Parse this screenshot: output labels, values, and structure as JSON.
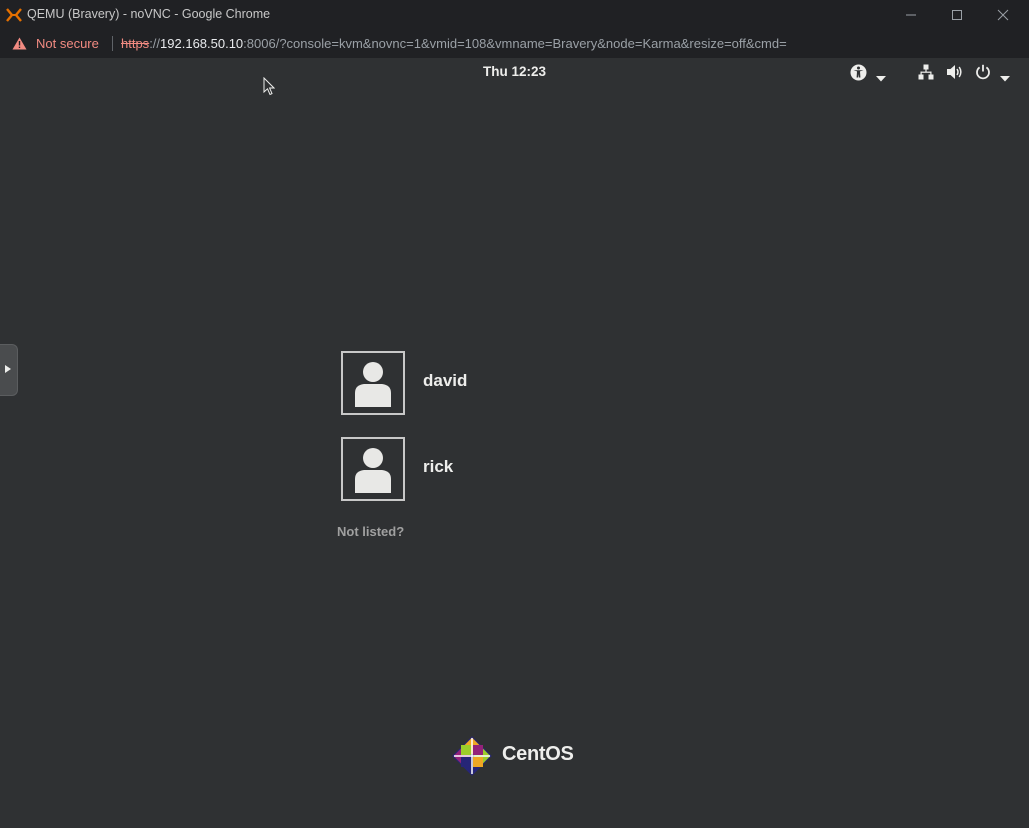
{
  "browser": {
    "window_title": "QEMU (Bravery) - noVNC - Google Chrome",
    "security_label": "Not secure",
    "url": {
      "scheme": "https",
      "separator": "://",
      "host": "192.168.50.10",
      "rest": ":8006/?console=kvm&novnc=1&vmid=108&vmname=Bravery&node=Karma&resize=off&cmd="
    },
    "window_buttons": [
      "minimize-icon",
      "maximize-icon",
      "close-icon"
    ]
  },
  "gnome": {
    "clock": "Thu 12:23",
    "tray_icons": [
      "accessibility-icon",
      "network-icon",
      "volume-icon",
      "power-icon"
    ]
  },
  "login": {
    "users": [
      {
        "name": "david"
      },
      {
        "name": "rick"
      }
    ],
    "not_listed": "Not listed?"
  },
  "branding": {
    "name": "CentOS"
  },
  "colors": {
    "desktop_bg": "#2f3133",
    "warning": "#f28b82",
    "app_icon": "#e57000"
  }
}
